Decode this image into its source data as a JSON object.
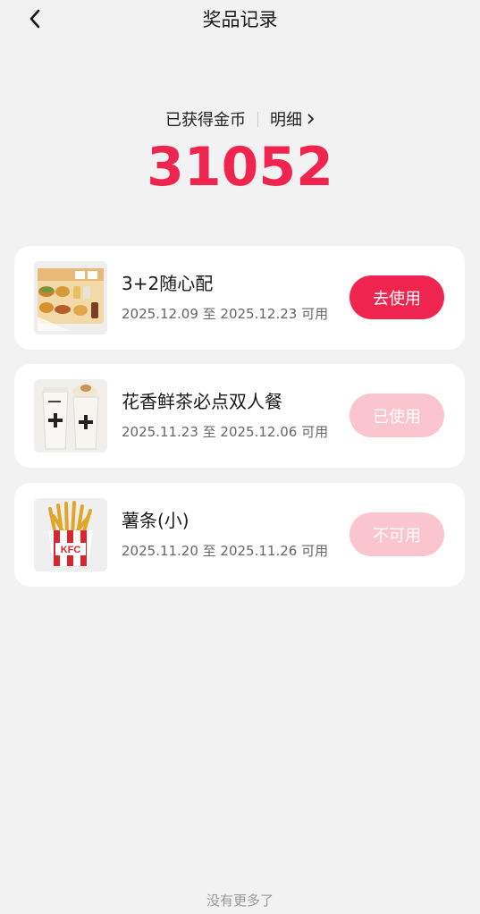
{
  "header": {
    "title": "奖品记录"
  },
  "coins": {
    "label": "已获得金币",
    "detail_link": "明细",
    "value": "31052"
  },
  "items": [
    {
      "name": "3+2随心配",
      "validity": "2025.12.09 至 2025.12.23 可用",
      "action_label": "去使用",
      "action_state": "active",
      "image_icon": "combo-meal-image"
    },
    {
      "name": "花香鲜茶必点双人餐",
      "validity": "2025.11.23 至 2025.12.06 可用",
      "action_label": "已使用",
      "action_state": "used",
      "image_icon": "tea-cups-image"
    },
    {
      "name": "薯条(小)",
      "validity": "2025.11.20 至 2025.11.26 可用",
      "action_label": "不可用",
      "action_state": "unavailable",
      "image_icon": "fries-image"
    }
  ],
  "footer": {
    "no_more": "没有更多了"
  },
  "colors": {
    "accent": "#f0254f",
    "muted_button": "#fbc5d0",
    "background": "#f2f2f2"
  }
}
